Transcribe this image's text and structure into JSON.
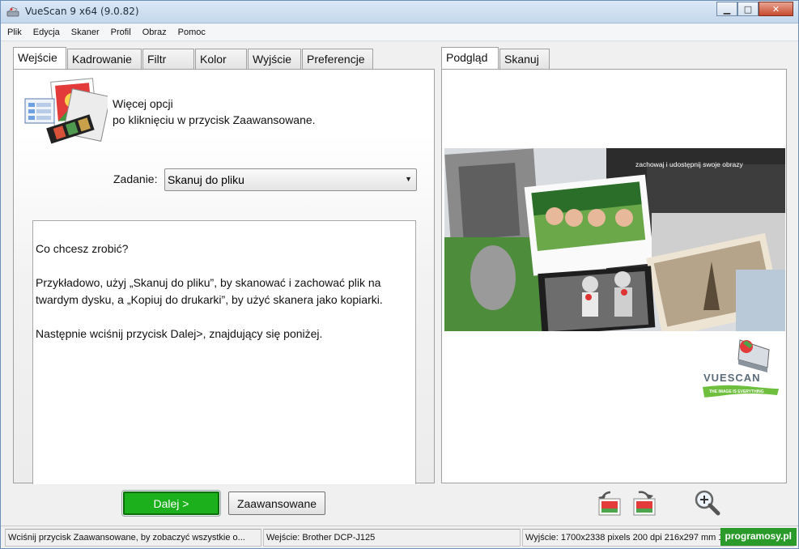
{
  "window": {
    "title": "VueScan 9 x64 (9.0.82)",
    "minimize": "▁",
    "maximize": "□",
    "close": "✕"
  },
  "menu": [
    "Plik",
    "Edycja",
    "Skaner",
    "Profil",
    "Obraz",
    "Pomoc"
  ],
  "left_tabs": [
    "Wejście",
    "Kadrowanie",
    "Filtr",
    "Kolor",
    "Wyjście",
    "Preferencje"
  ],
  "right_tabs": [
    "Podgląd",
    "Skanuj"
  ],
  "info": {
    "line1": "Więcej opcji",
    "line2": "po kliknięciu w przycisk Zaawansowane."
  },
  "task": {
    "label": "Zadanie:",
    "value": "Skanuj do pliku"
  },
  "help": {
    "p1": "Co chcesz zrobić?",
    "p2": "Przykładowo, użyj „Skanuj do pliku”, by skanować i zachować plik na twardym dysku, a „Kopiuj do drukarki”, by użyć skanera jako kopiarki.",
    "p3": "Następnie wciśnij przycisk Dalej>, znajdujący się poniżej."
  },
  "preview": {
    "banner_text": "zachowaj i udostępnij swoje obrazy",
    "logo_text": "VUESCAN",
    "logo_tagline": "THE IMAGE IS EVERYTHING"
  },
  "buttons": {
    "next": "Dalej >",
    "advanced": "Zaawansowane"
  },
  "status": {
    "hint": "Wciśnij przycisk Zaawansowane, by zobaczyć wszystkie o...",
    "input": "Wejście: Brother DCP-J125",
    "output": "Wyjście: 1700x2338 pixels 200 dpi 216x297 mm 1..."
  },
  "watermark": "programosy.pl",
  "colors": {
    "next_button": "#1db01d",
    "accent_green": "#3aa83a"
  }
}
